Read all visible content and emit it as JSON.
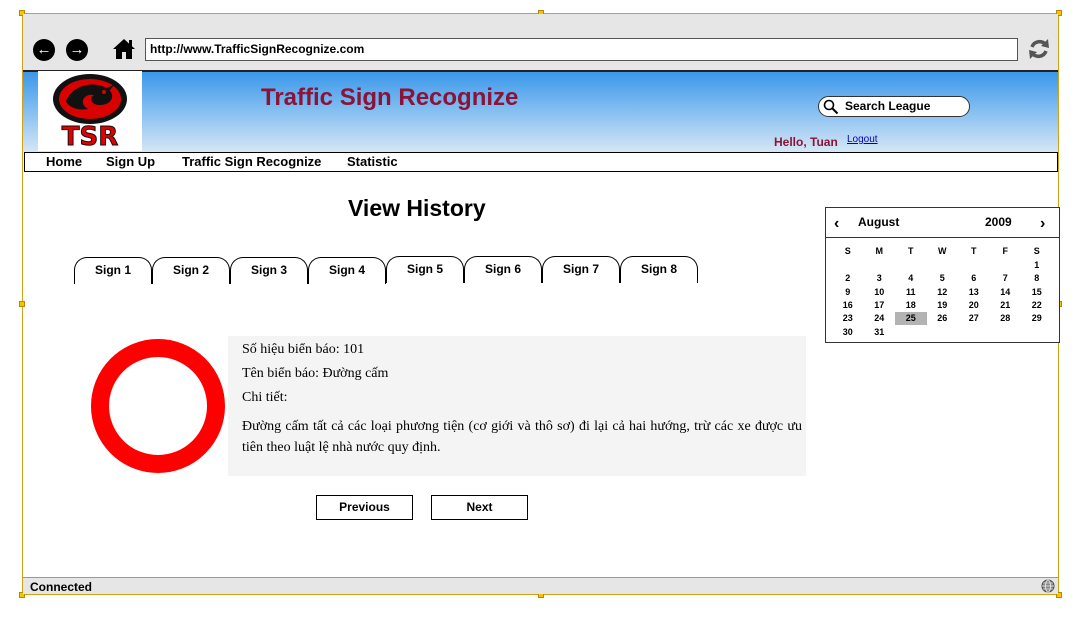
{
  "browser": {
    "url": "http://www.TrafficSignRecognize.com"
  },
  "header": {
    "logo_text": "TSR",
    "site_title": "Traffic Sign Recognize",
    "search_placeholder": "Search League",
    "greeting": "Hello, Tuan",
    "logout_label": "Logout"
  },
  "menu": {
    "items": [
      {
        "label": "Home"
      },
      {
        "label": "Sign Up"
      },
      {
        "label": "Traffic Sign Recognize"
      },
      {
        "label": "Statistic"
      }
    ]
  },
  "main": {
    "page_title": "View History",
    "tabs": [
      {
        "label": "Sign 1"
      },
      {
        "label": "Sign 2"
      },
      {
        "label": "Sign 3"
      },
      {
        "label": "Sign 4"
      },
      {
        "label": "Sign 5"
      },
      {
        "label": "Sign 6"
      },
      {
        "label": "Sign 7"
      },
      {
        "label": "Sign 8"
      }
    ],
    "detail": {
      "code_line": "Số hiệu biển báo: 101",
      "name_line": "Tên biển báo: Đường cấm",
      "detail_label": "Chi tiết:",
      "description": "Đường cấm tất cả các loại phương tiện (cơ giới và thô sơ) đi lại cả hai hướng, trừ các xe được ưu tiên theo luật lệ nhà nước quy định."
    },
    "previous_label": "Previous",
    "next_label": "Next"
  },
  "calendar": {
    "month": "August",
    "year": "2009",
    "weekdays": [
      "S",
      "M",
      "T",
      "W",
      "T",
      "F",
      "S"
    ],
    "weeks": [
      [
        "",
        "",
        "",
        "",
        "",
        "",
        "1"
      ],
      [
        "2",
        "3",
        "4",
        "5",
        "6",
        "7",
        "8"
      ],
      [
        "9",
        "10",
        "11",
        "12",
        "13",
        "14",
        "15"
      ],
      [
        "16",
        "17",
        "18",
        "19",
        "20",
        "21",
        "22"
      ],
      [
        "23",
        "24",
        "25",
        "26",
        "27",
        "28",
        "29"
      ],
      [
        "30",
        "31",
        "",
        "",
        "",
        "",
        ""
      ]
    ],
    "selected_day": "25"
  },
  "status": {
    "text": "Connected"
  },
  "colors": {
    "title_color": "#8b1338",
    "sign_red": "#ff0000",
    "header_blue": "#3b97ea"
  }
}
